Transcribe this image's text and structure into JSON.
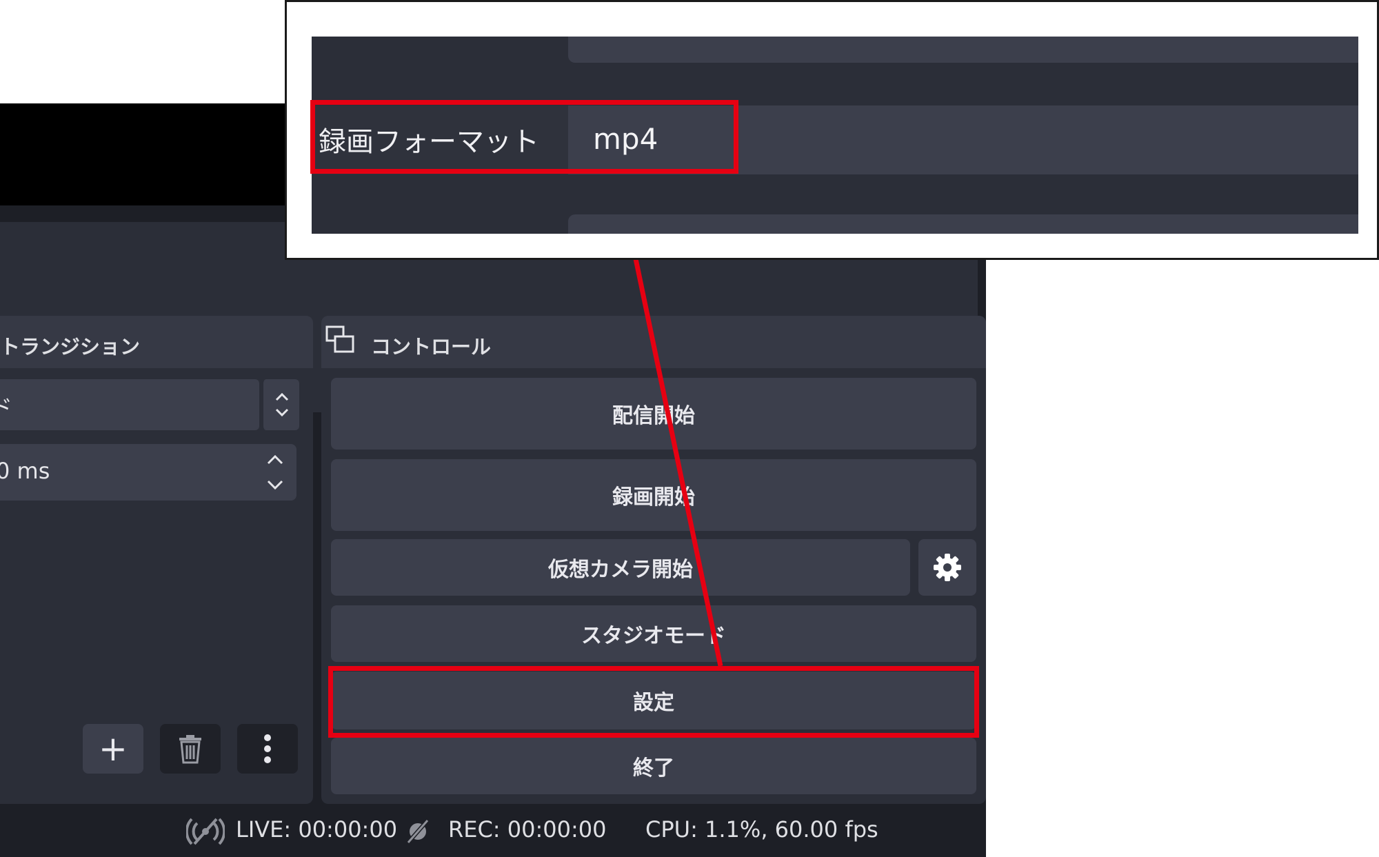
{
  "transitions": {
    "title": "トランジション",
    "selected_transition": "ド",
    "duration": "0 ms",
    "add_label": "+",
    "remove_icon": "trash-icon",
    "more_label": "⋮"
  },
  "controls": {
    "title": "コントロール",
    "buttons": {
      "start_streaming": "配信開始",
      "start_recording": "録画開始",
      "start_virtual_camera": "仮想カメラ開始",
      "studio_mode": "スタジオモード",
      "settings": "設定",
      "exit": "終了"
    }
  },
  "status_bar": {
    "live": "LIVE: 00:00:00",
    "rec": "REC: 00:00:00",
    "cpu": "CPU: 1.1%, 60.00 fps"
  },
  "zoom_inset": {
    "recording_format_label": "録画フォーマット",
    "recording_format_value": "mp4"
  },
  "colors": {
    "annotation_red": "#e60012",
    "panel_bg": "#2b2e38",
    "button_bg": "#3c3f4c"
  }
}
